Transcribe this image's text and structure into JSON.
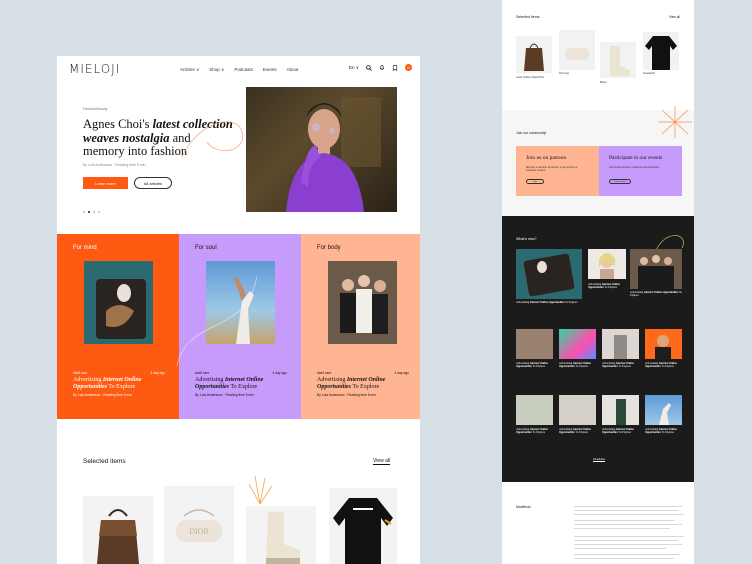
{
  "colors": {
    "background": "#d7dfe6",
    "accent": "#ff5a12",
    "lavender": "#c69bfb",
    "peach": "#ffb592",
    "dark": "#1b1b1b"
  },
  "left": {
    "logo": "MIELOJI",
    "menu": [
      "Articles ∨",
      "Shop ∨",
      "Podcasts",
      "Events",
      "About"
    ],
    "lang": "En ∨",
    "cart_count": "0",
    "hero": {
      "tag": "Fashion/beauty",
      "title_pre": "Agnes Choi's ",
      "title_em": "latest collection weaves nostalgia",
      "title_post": " and memory into fashion",
      "byline": "By Lola Andersson · Reading time 5 min",
      "primary_btn": "Learn more",
      "secondary_btn": "All articles"
    },
    "columns": [
      {
        "label": "For mind",
        "tag": "#self care",
        "date": "4 day ago",
        "title_pre": "Advertising ",
        "title_em": "Internet Online Opportunities",
        "title_post": " To Explore",
        "by": "By Lola Andersson · Reading time 5 min"
      },
      {
        "label": "For soul",
        "tag": "#self care",
        "date": "4 day ago",
        "title_pre": "Advertising ",
        "title_em": "Internet Online Opportunities",
        "title_post": " To Explore",
        "by": "By Lola Andersson · Reading time 5 min"
      },
      {
        "label": "For body",
        "tag": "#self care",
        "date": "4 day ago",
        "title_pre": "Advertising ",
        "title_em": "Internet Online Opportunities",
        "title_post": " To Explore",
        "by": "By Lola Andersson · Reading time 5 min"
      }
    ],
    "selected_title": "Selected items",
    "view_all": "View all",
    "product_print": "DIOR"
  },
  "right": {
    "selected_title": "Selected items",
    "view_all": "View all",
    "products": [
      "Louis Vuitton Rapid Tote",
      "Dior bag",
      "Boots",
      "Sweatshirt"
    ],
    "community_label": "Join our community!",
    "patreon_title": "Join us on patreon",
    "patreon_desc": "Become a member of patreon to get access to exclusive content.",
    "patreon_btn": "Join",
    "events_title": "Participate in our events",
    "events_desc": "Join public lectures, meetings and workshops.",
    "events_btn": "Learn more",
    "whats_new": "What's new?",
    "news_pre": "Advertising ",
    "news_em": "Internet Online Opportunities",
    "news_post": " To Explore",
    "all_articles": "All articles",
    "manifesto": "Manifesto"
  }
}
